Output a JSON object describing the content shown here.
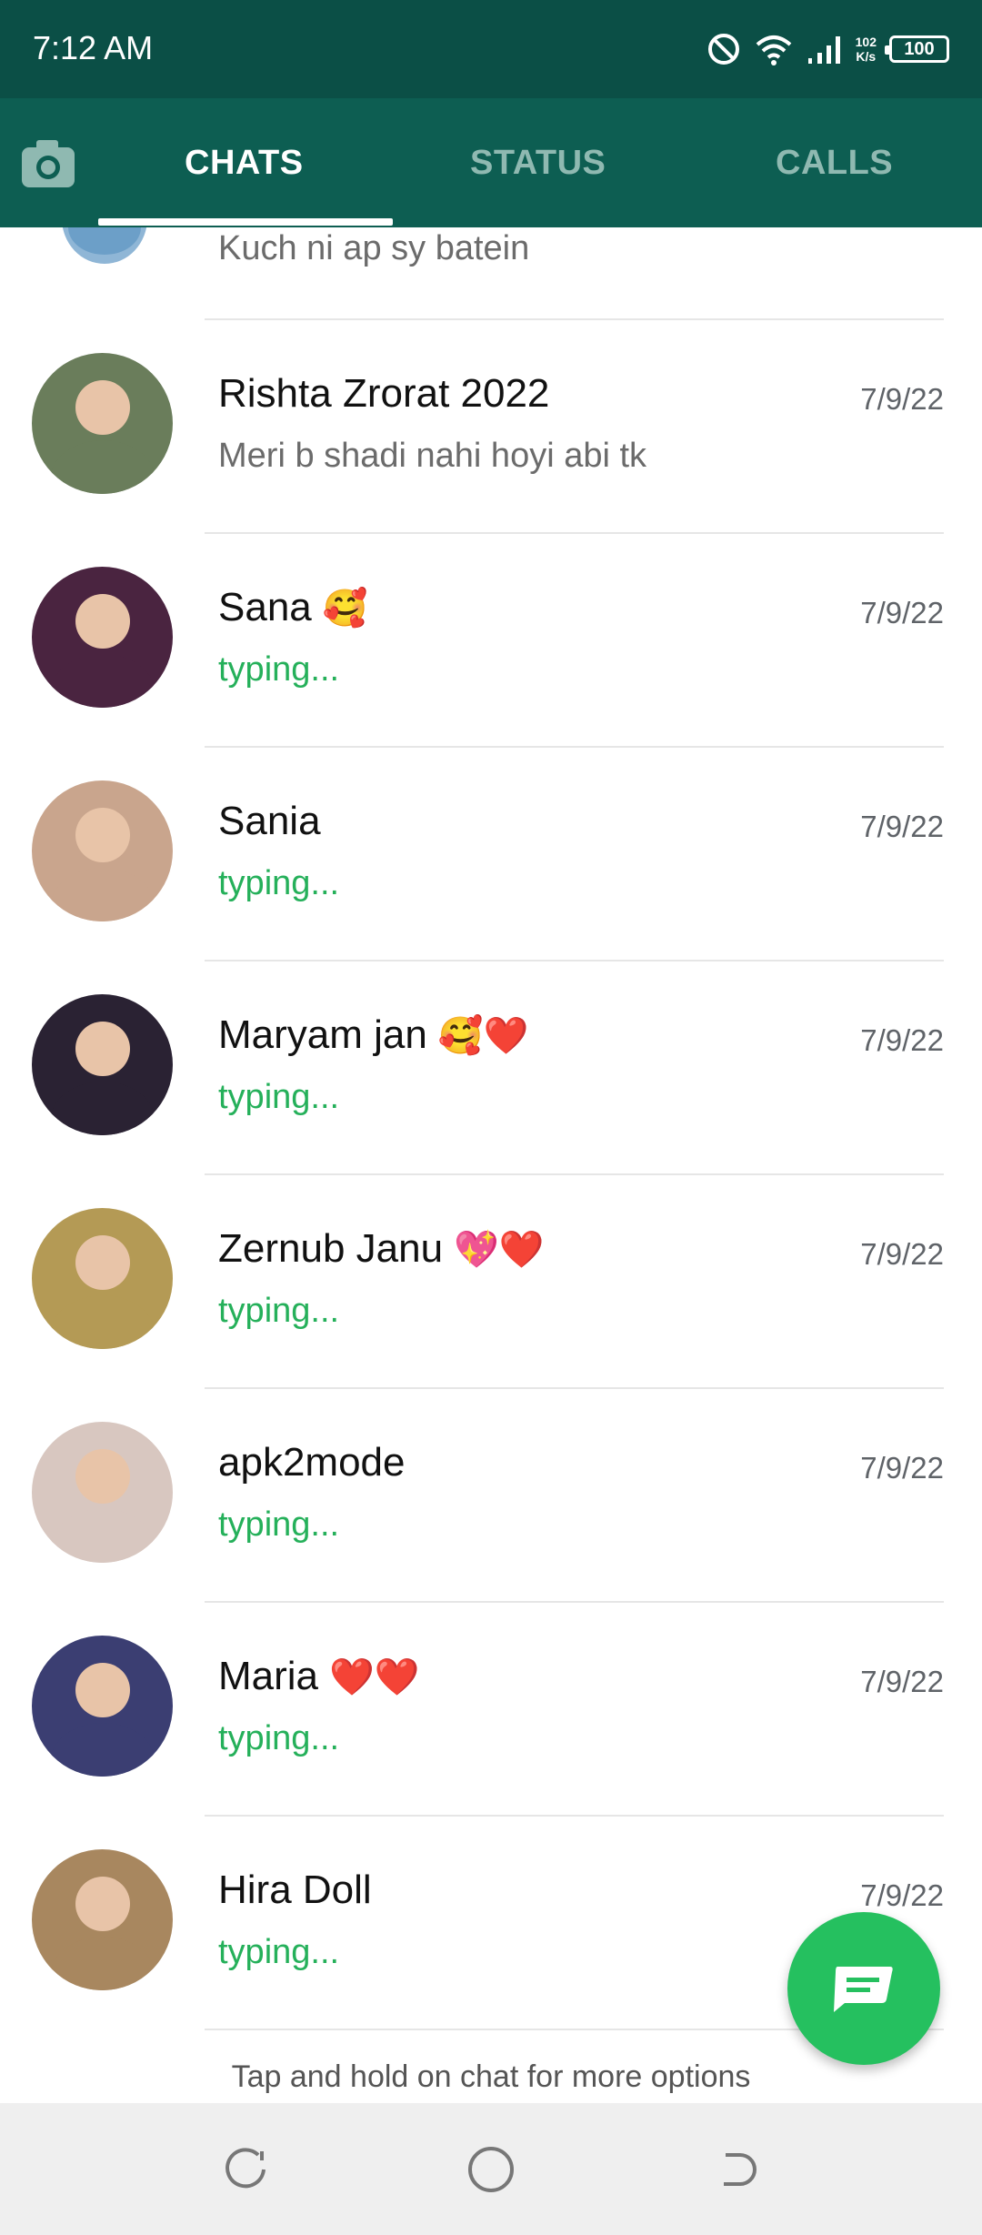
{
  "status_bar": {
    "time": "7:12 AM",
    "speed_value": "102",
    "speed_unit": "K/s",
    "battery": "100",
    "icons": [
      "dnd-icon",
      "wifi-icon",
      "signal-icon",
      "battery-icon"
    ]
  },
  "tabs": {
    "camera_icon": "camera-icon",
    "items": [
      {
        "label": "CHATS",
        "active": true
      },
      {
        "label": "STATUS",
        "active": false
      },
      {
        "label": "CALLS",
        "active": false
      }
    ]
  },
  "partial_chat": {
    "subtitle": "Kuch ni ap sy batein"
  },
  "chats": [
    {
      "name": "Rishta Zrorat 2022",
      "emoji": "",
      "date": "7/9/22",
      "subtitle": "Meri b shadi nahi hoyi abi tk",
      "typing": false,
      "avatar_color": "#6a7d5b"
    },
    {
      "name": "Sana",
      "emoji": "🥰",
      "date": "7/9/22",
      "subtitle": "typing...",
      "typing": true,
      "avatar_color": "#4a2440"
    },
    {
      "name": "Sania",
      "emoji": "",
      "date": "7/9/22",
      "subtitle": "typing...",
      "typing": true,
      "avatar_color": "#c9a58d"
    },
    {
      "name": "Maryam jan",
      "emoji": "🥰❤️",
      "date": "7/9/22",
      "subtitle": "typing...",
      "typing": true,
      "avatar_color": "#2a2233"
    },
    {
      "name": "Zernub Janu",
      "emoji": "💖❤️",
      "date": "7/9/22",
      "subtitle": "typing...",
      "typing": true,
      "avatar_color": "#b49a55"
    },
    {
      "name": "apk2mode",
      "emoji": "",
      "date": "7/9/22",
      "subtitle": "typing...",
      "typing": true,
      "avatar_color": "#d8c7c0"
    },
    {
      "name": "Maria",
      "emoji": "❤️❤️",
      "date": "7/9/22",
      "subtitle": "typing...",
      "typing": true,
      "avatar_color": "#3b3e72"
    },
    {
      "name": "Hira Doll",
      "emoji": "",
      "date": "7/9/22",
      "subtitle": "typing...",
      "typing": true,
      "avatar_color": "#a8875f"
    }
  ],
  "hint": "Tap and hold on chat for more options",
  "fab": {
    "icon": "new-chat-icon",
    "color": "#25c05f"
  },
  "nav": {
    "icons": [
      "recent-apps-icon",
      "home-icon",
      "back-icon"
    ]
  },
  "colors": {
    "header": "#0d5e52",
    "status_bar": "#0b4f46",
    "typing": "#25b05a"
  }
}
